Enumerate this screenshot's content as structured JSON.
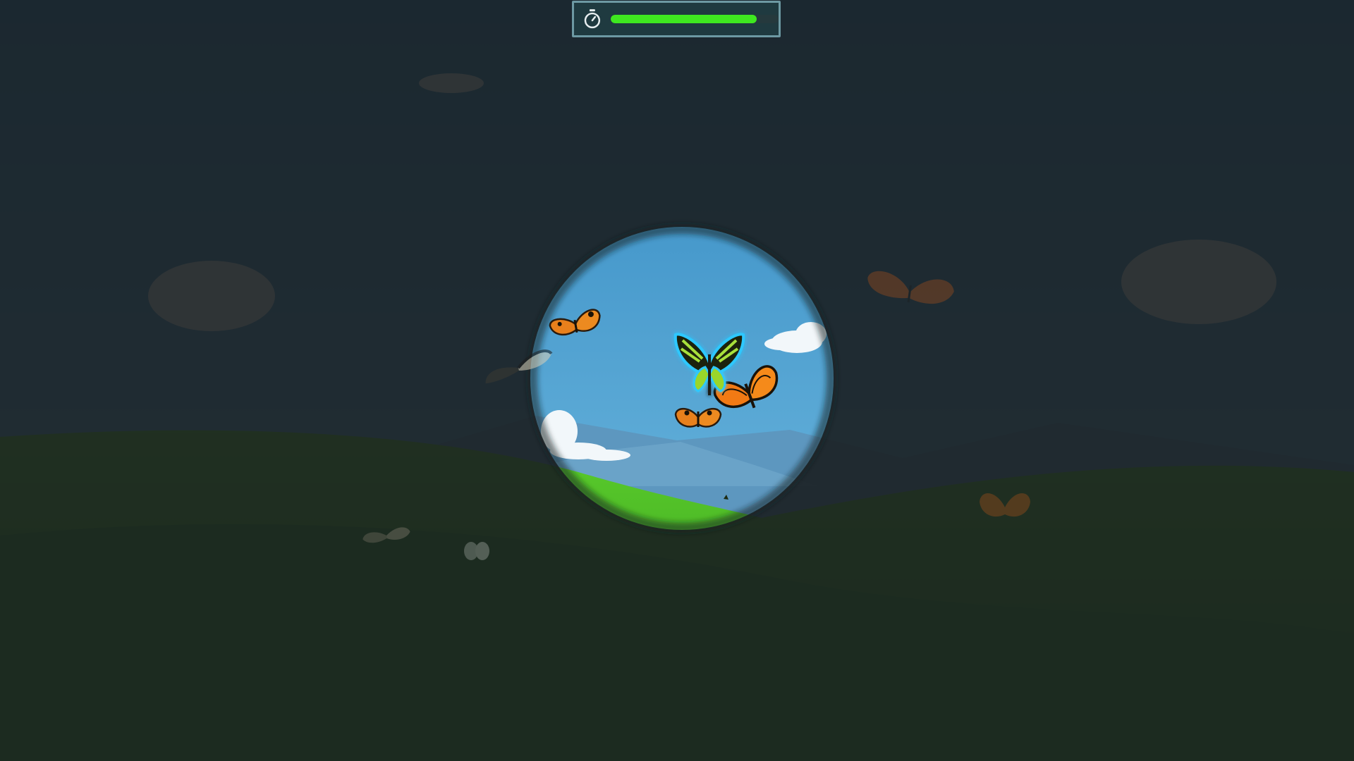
{
  "hud": {
    "timer_icon": "stopwatch-icon",
    "time_remaining_fraction": 0.87,
    "bar_color": "#3ee820",
    "frame_color": "#6d99a3"
  },
  "scene": {
    "sky_color": "#3e95c8",
    "grass_color": "#4cbf2a",
    "mountain_color": "#5a9bc4",
    "overlay_color": "#1a1e20",
    "highlight_color": "#2ec8ff"
  },
  "butterflies": [
    {
      "species": "birdwing",
      "highlighted": true,
      "in_view": true
    },
    {
      "species": "monarch",
      "highlighted": false,
      "in_view": true
    },
    {
      "species": "painted-lady",
      "highlighted": false,
      "in_view": true
    },
    {
      "species": "painted-lady",
      "highlighted": false,
      "in_view": true
    },
    {
      "species": "swallowtail",
      "highlighted": false,
      "in_view": false
    },
    {
      "species": "monarch",
      "highlighted": false,
      "in_view": false
    },
    {
      "species": "monarch",
      "highlighted": false,
      "in_view": false
    },
    {
      "species": "moth",
      "highlighted": false,
      "in_view": false
    },
    {
      "species": "white",
      "highlighted": false,
      "in_view": false
    }
  ]
}
